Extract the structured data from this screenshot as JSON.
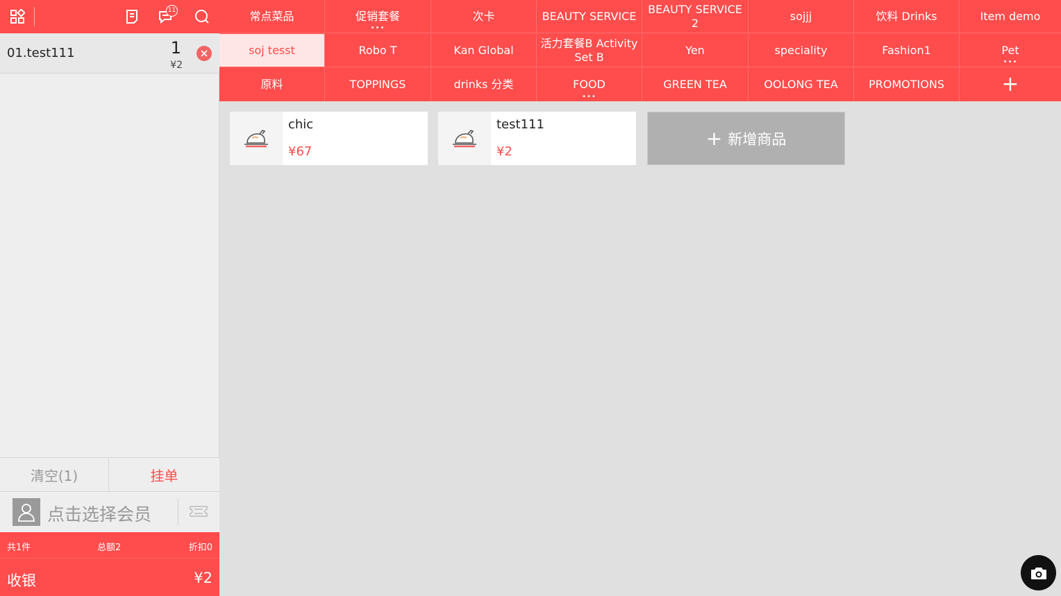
{
  "header": {
    "icons": [
      "grid-icon",
      "receipt-icon",
      "message-icon",
      "search-icon"
    ],
    "message_badge": "11"
  },
  "order": {
    "items": [
      {
        "name": "01.test111",
        "qty": "1",
        "price": "¥2"
      }
    ]
  },
  "actions": {
    "clear_label": "清空(1)",
    "hold_label": "挂单"
  },
  "member": {
    "placeholder": "点击选择会员"
  },
  "summary": {
    "count": "共1件",
    "total": "总额2",
    "discount": "折扣0"
  },
  "checkout": {
    "label": "收银",
    "total": "¥2"
  },
  "categories": {
    "row1": [
      "常点菜品",
      "促销套餐",
      "次卡",
      "BEAUTY SERVICE",
      "BEAUTY SERVICE 2",
      "sojjj",
      "饮料 Drinks",
      "Item demo"
    ],
    "row2": [
      "soj tesst",
      "Robo T",
      "Kan Global",
      "活力套餐B Activity Set B",
      "Yen",
      "speciality",
      "Fashion1",
      "Pet"
    ],
    "row3": [
      "原料",
      "TOPPINGS",
      "drinks 分类",
      "FOOD",
      "GREEN TEA",
      "OOLONG TEA",
      "PROMOTIONS",
      "+"
    ],
    "selected": "soj tesst"
  },
  "products": [
    {
      "name": "chic",
      "price": "¥67"
    },
    {
      "name": "test111",
      "price": "¥2"
    }
  ],
  "add_product": {
    "plus": "+",
    "label": "新增商品"
  },
  "colors": {
    "accent": "#ff4c4c",
    "selected_bg": "#ffe6e6",
    "panel": "#eeeeee",
    "canvas": "#e0e0e0"
  }
}
